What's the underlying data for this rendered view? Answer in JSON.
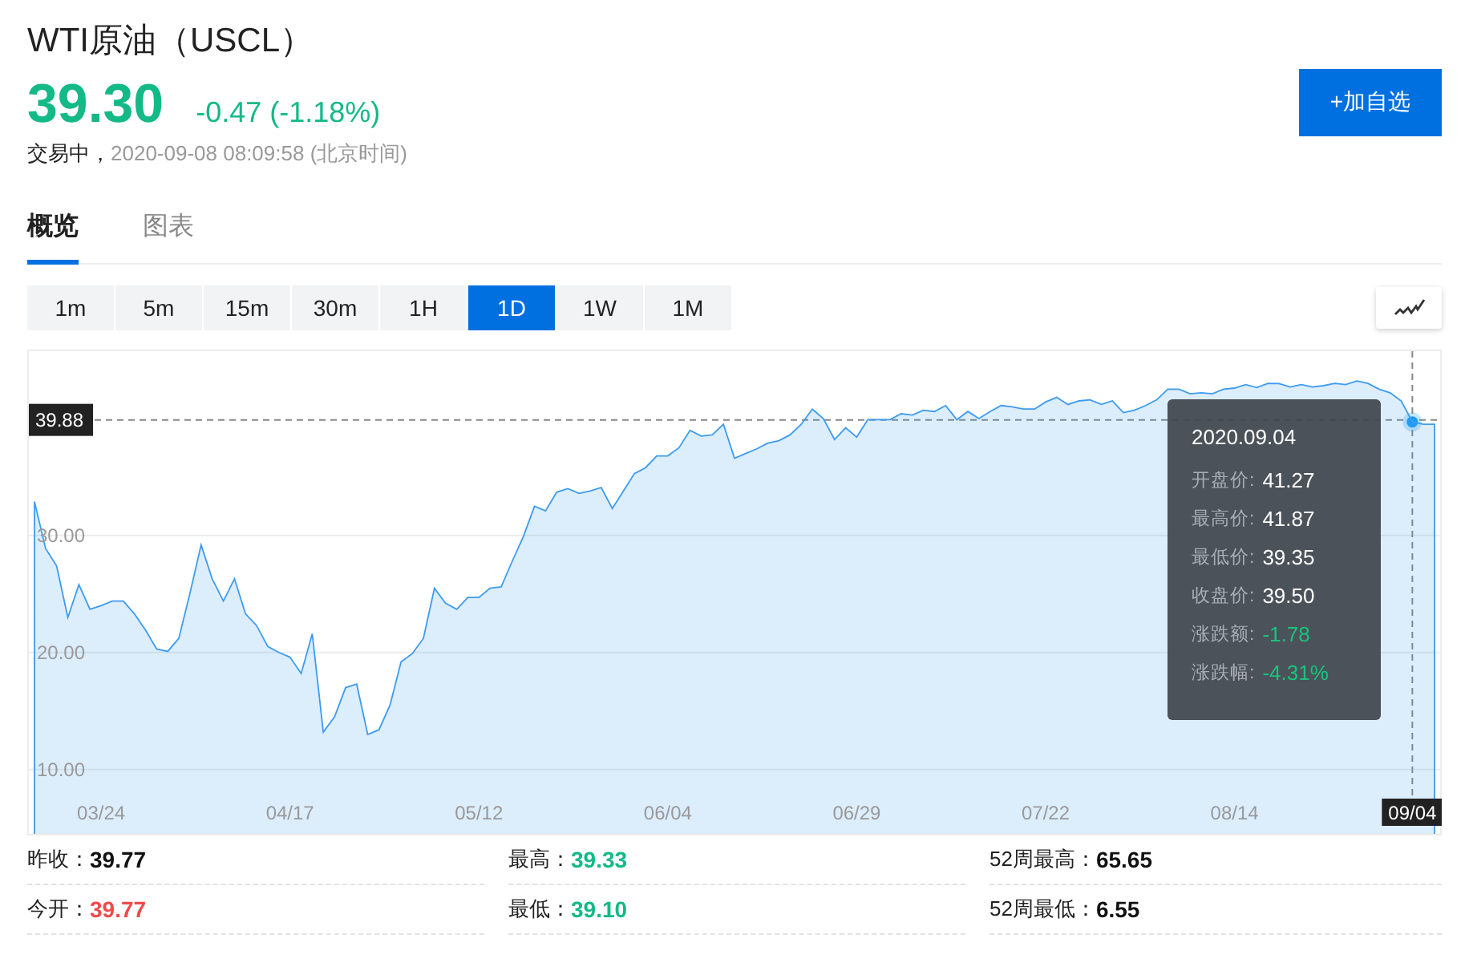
{
  "header": {
    "title": "WTI原油（USCL）",
    "price": "39.30",
    "change": "-0.47 (-1.18%)",
    "color": "#13b987",
    "status": "交易中，",
    "time": "2020-09-08 08:09:58 (北京时间)",
    "watch_button": "+加自选"
  },
  "tabs": [
    {
      "label": "概览",
      "selected": true
    },
    {
      "label": "图表",
      "selected": false
    }
  ],
  "periods": [
    {
      "label": "1m",
      "selected": false
    },
    {
      "label": "5m",
      "selected": false
    },
    {
      "label": "15m",
      "selected": false
    },
    {
      "label": "30m",
      "selected": false
    },
    {
      "label": "1H",
      "selected": false
    },
    {
      "label": "1D",
      "selected": true
    },
    {
      "label": "1W",
      "selected": false
    },
    {
      "label": "1M",
      "selected": false
    }
  ],
  "chart": {
    "tooltip": {
      "date": "2020.09.04",
      "rows": [
        {
          "label": "开盘价:",
          "value": "41.27",
          "color": "#ffffff"
        },
        {
          "label": "最高价:",
          "value": "41.87",
          "color": "#ffffff"
        },
        {
          "label": "最低价:",
          "value": "39.35",
          "color": "#ffffff"
        },
        {
          "label": "收盘价:",
          "value": "39.50",
          "color": "#ffffff"
        },
        {
          "label": "涨跌额:",
          "value": "-1.78",
          "color": "#19c37d"
        },
        {
          "label": "涨跌幅:",
          "value": "-4.31%",
          "color": "#19c37d"
        }
      ]
    },
    "chart_data": {
      "type": "area",
      "grid": true,
      "ylim": [
        4.5,
        45.75
      ],
      "yticks": [
        {
          "value": 10,
          "label": "10.00"
        },
        {
          "value": 20,
          "label": "20.00"
        },
        {
          "value": 30,
          "label": "30.00"
        }
      ],
      "ref_lines": [
        {
          "axis": "y",
          "value": 39.88,
          "label": "39.88"
        },
        {
          "axis": "x",
          "value": "09/04"
        }
      ],
      "categories": [
        null,
        null,
        null,
        null,
        null,
        null,
        "03/24",
        null,
        null,
        null,
        null,
        null,
        null,
        null,
        null,
        null,
        null,
        null,
        null,
        null,
        null,
        null,
        null,
        "04/17",
        null,
        null,
        null,
        null,
        null,
        null,
        null,
        null,
        null,
        null,
        null,
        null,
        null,
        null,
        null,
        null,
        "05/12",
        null,
        null,
        null,
        null,
        null,
        null,
        null,
        null,
        null,
        null,
        null,
        null,
        null,
        null,
        null,
        null,
        "06/04",
        null,
        null,
        null,
        null,
        null,
        null,
        null,
        null,
        null,
        null,
        null,
        null,
        null,
        null,
        null,
        null,
        "06/29",
        null,
        null,
        null,
        null,
        null,
        null,
        null,
        null,
        null,
        null,
        null,
        null,
        null,
        null,
        null,
        null,
        "07/22",
        null,
        null,
        null,
        null,
        null,
        null,
        null,
        null,
        null,
        null,
        null,
        null,
        null,
        null,
        null,
        null,
        "08/14",
        null,
        null,
        null,
        null,
        null,
        null,
        null,
        null,
        null,
        null,
        null,
        null,
        null,
        null,
        null,
        "09/04",
        null,
        null
      ],
      "series": [
        {
          "color": "#3d9bf0",
          "values": [
            32.9,
            28.9,
            27.4,
            23.0,
            25.8,
            23.7,
            24.0,
            24.4,
            24.4,
            23.3,
            21.9,
            20.3,
            20.1,
            21.2,
            25.1,
            29.2,
            26.3,
            24.4,
            26.3,
            23.3,
            22.3,
            20.5,
            20.0,
            19.6,
            18.2,
            21.6,
            13.2,
            14.5,
            17.0,
            17.3,
            13.0,
            13.4,
            15.5,
            19.2,
            19.9,
            21.2,
            25.5,
            24.2,
            23.7,
            24.7,
            24.7,
            25.5,
            25.6,
            27.8,
            29.9,
            32.5,
            32.1,
            33.7,
            34.0,
            33.6,
            33.8,
            34.1,
            32.3,
            33.8,
            35.3,
            35.8,
            36.8,
            36.8,
            37.5,
            39.0,
            38.5,
            38.6,
            39.5,
            36.6,
            37.0,
            37.4,
            37.9,
            38.1,
            38.6,
            39.5,
            40.8,
            40.0,
            38.2,
            39.2,
            38.4,
            39.9,
            39.9,
            39.9,
            40.4,
            40.3,
            40.7,
            40.6,
            41.1,
            39.9,
            40.6,
            40.0,
            40.6,
            41.1,
            41.0,
            40.8,
            40.8,
            41.4,
            41.8,
            41.2,
            41.5,
            41.6,
            41.2,
            41.5,
            40.5,
            40.7,
            41.1,
            41.6,
            42.5,
            42.5,
            42.1,
            42.2,
            42.1,
            42.5,
            42.6,
            42.9,
            42.64,
            43.0,
            42.98,
            42.7,
            42.9,
            42.7,
            42.81,
            43.0,
            42.9,
            43.2,
            43.0,
            42.5,
            42.2,
            41.5,
            39.7,
            39.5,
            39.5
          ]
        }
      ]
    }
  },
  "stats": [
    {
      "label": "昨收：",
      "value": "39.77",
      "color": "#111111"
    },
    {
      "label": "最高：",
      "value": "39.33",
      "color": "#13b987"
    },
    {
      "label": "52周最高：",
      "value": "65.65",
      "color": "#111111"
    },
    {
      "label": "今开：",
      "value": "39.77",
      "color": "#f04949"
    },
    {
      "label": "最低：",
      "value": "39.10",
      "color": "#13b987"
    },
    {
      "label": "52周最低：",
      "value": "6.55",
      "color": "#111111"
    }
  ]
}
